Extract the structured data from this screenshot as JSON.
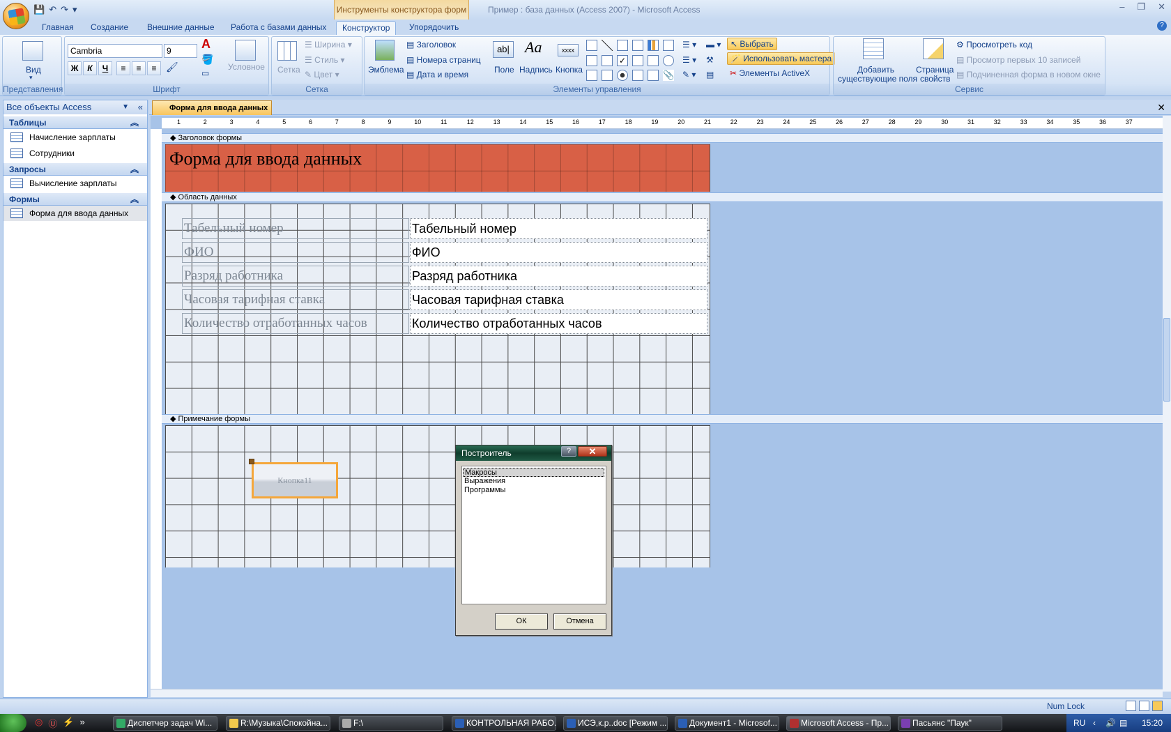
{
  "window": {
    "title": "Пример : база данных (Access 2007) - Microsoft Access",
    "context_tab": "Инструменты конструктора форм"
  },
  "ribbon_tabs": [
    "Главная",
    "Создание",
    "Внешние данные",
    "Работа с базами данных",
    "Конструктор",
    "Упорядочить"
  ],
  "ribbon": {
    "views": {
      "button": "Вид",
      "group": "Представления"
    },
    "font": {
      "name": "Cambria",
      "size": "9",
      "bold": "Ж",
      "italic": "К",
      "underline": "Ч",
      "conditional": "Условное",
      "group": "Шрифт"
    },
    "gridlines": {
      "button": "Сетка",
      "width": "Ширина",
      "style": "Стиль",
      "color": "Цвет",
      "group": "Сетка"
    },
    "controls": {
      "logo": "Эмблема",
      "title": "Заголовок",
      "page_numbers": "Номера страниц",
      "date_time": "Дата и время",
      "field": "Поле",
      "label": "Надпись",
      "button": "Кнопка",
      "button_icon": "xxxx",
      "select": "Выбрать",
      "wizards": "Использовать мастера",
      "activex": "Элементы ActiveX",
      "group": "Элементы управления"
    },
    "tools": {
      "add_fields_1": "Добавить",
      "add_fields_2": "существующие поля",
      "props_1": "Страница",
      "props_2": "свойств",
      "view_code": "Просмотреть код",
      "top10": "Просмотр первых 10 записей",
      "subform": "Подчиненная форма в новом окне",
      "group": "Сервис"
    }
  },
  "nav": {
    "header": "Все объекты Access",
    "groups": [
      {
        "name": "Таблицы",
        "items": [
          "Начисление зарплаты",
          "Сотрудники"
        ]
      },
      {
        "name": "Запросы",
        "items": [
          "Вычисление зарплаты"
        ]
      },
      {
        "name": "Формы",
        "items": [
          "Форма для ввода данных"
        ]
      }
    ]
  },
  "document": {
    "tab": "Форма для ввода данных",
    "sections": {
      "header": "Заголовок формы",
      "detail": "Область данных",
      "footer": "Примечание формы"
    },
    "form_title": "Форма для ввода данных",
    "fields": [
      {
        "label": "Табельный номер",
        "control": "Табельный номер"
      },
      {
        "label": "ФИО",
        "control": "ФИО"
      },
      {
        "label": "Разряд работника",
        "control": "Разряд работника"
      },
      {
        "label": "Часовая тарифная ставка",
        "control": "Часовая тарифная ставка"
      },
      {
        "label": "Количество отработанных часов",
        "control": "Количество отработанных часов"
      }
    ],
    "footer_button": "Кнопка11",
    "hruler_ticks": [
      "1",
      "2",
      "3",
      "4",
      "5",
      "6",
      "7",
      "8",
      "9",
      "10",
      "11",
      "12",
      "13",
      "14",
      "15",
      "16",
      "17",
      "18",
      "19",
      "20",
      "21",
      "22",
      "23",
      "24",
      "25",
      "26",
      "27",
      "28",
      "29",
      "30",
      "31",
      "32",
      "33",
      "34",
      "35",
      "36",
      "37"
    ]
  },
  "dialog": {
    "title": "Построитель",
    "help": "?",
    "close": "✕",
    "items": [
      "Макросы",
      "Выражения",
      "Программы"
    ],
    "selected": "Макросы",
    "ok": "ОК",
    "cancel": "Отмена"
  },
  "status": {
    "numlock": "Num Lock"
  },
  "taskbar": {
    "items": [
      "Диспетчер задач Wi...",
      "R:\\Музыка\\Спокойна...",
      "F:\\",
      "КОНТРОЛЬНАЯ РАБО...",
      "ИСЭ,к.р..doc [Режим ...",
      "Документ1 - Microsof...",
      "Microsoft Access - Пр...",
      "Пасьянс \"Паук\""
    ],
    "active": "Microsoft Access - Пр...",
    "lang": "RU",
    "clock": "15:20"
  },
  "colors": {
    "accent": "#15428b",
    "form_header": "#d86046",
    "selection": "#f5a73b"
  }
}
